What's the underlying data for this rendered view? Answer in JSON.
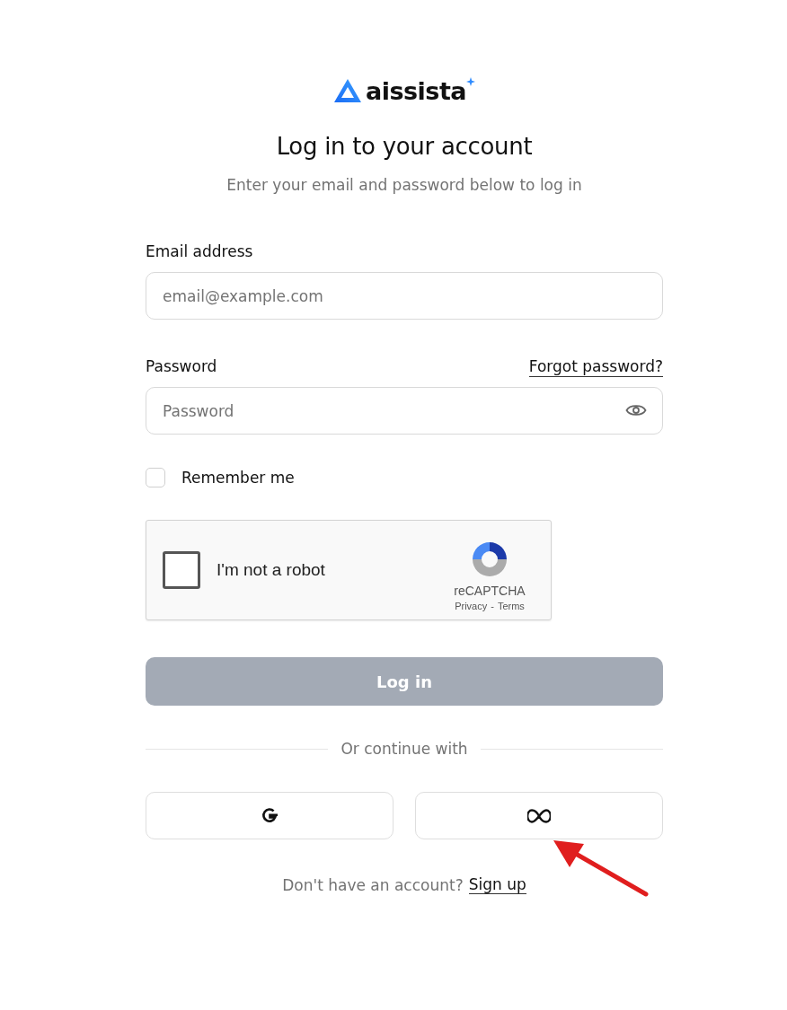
{
  "logo": {
    "name": "aissista"
  },
  "title": "Log in to your account",
  "subtitle": "Enter your email and password below to log in",
  "email": {
    "label": "Email address",
    "placeholder": "email@example.com"
  },
  "password": {
    "label": "Password",
    "placeholder": "Password",
    "forgot_link": "Forgot password?",
    "visible": false
  },
  "remember": {
    "label": "Remember me",
    "checked": false
  },
  "captcha": {
    "label": "I'm not a robot",
    "checked": false,
    "brand": "reCAPTCHA",
    "privacy": "Privacy",
    "separator": "-",
    "terms": "Terms"
  },
  "login_button": {
    "label": "Log in",
    "disabled": true
  },
  "divider": "Or continue with",
  "social_buttons": [
    {
      "kind": "google"
    },
    {
      "kind": "meta"
    }
  ],
  "signup": {
    "text": "Don't have an account?",
    "link": "Sign up"
  },
  "annotation": {
    "kind": "arrow"
  }
}
